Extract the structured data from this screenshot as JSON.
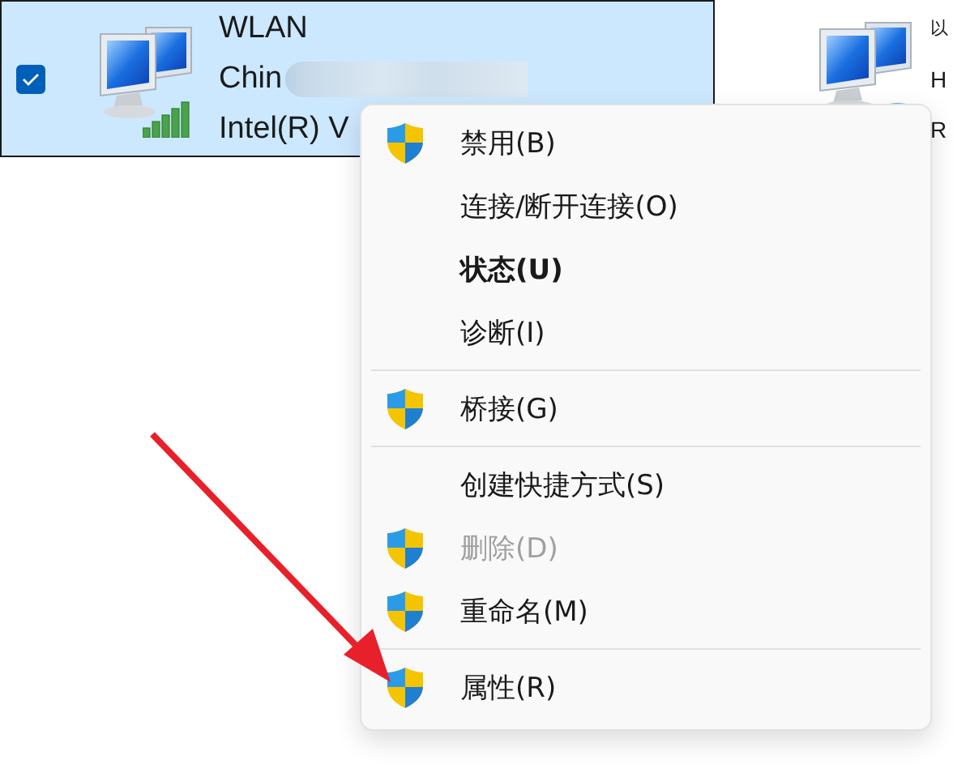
{
  "adapters": [
    {
      "name": "WLAN",
      "line_2": "Chin",
      "line_3": "Intel(R) V",
      "selected": true,
      "checked": true,
      "kind": "wireless",
      "blurred": true
    },
    {
      "name": "以",
      "line_2": "H",
      "line_3": "R",
      "selected": false,
      "kind": "wired"
    }
  ],
  "context_menu": {
    "items": [
      {
        "kind": "item",
        "label": "禁用(B)",
        "shield": true,
        "disabled": false,
        "default": false
      },
      {
        "kind": "item",
        "label": "连接/断开连接(O)",
        "shield": false,
        "disabled": false,
        "default": false
      },
      {
        "kind": "item",
        "label": "状态(U)",
        "shield": false,
        "disabled": false,
        "default": true
      },
      {
        "kind": "item",
        "label": "诊断(I)",
        "shield": false,
        "disabled": false,
        "default": false
      },
      {
        "kind": "separator"
      },
      {
        "kind": "item",
        "label": "桥接(G)",
        "shield": true,
        "disabled": false,
        "default": false
      },
      {
        "kind": "separator"
      },
      {
        "kind": "item",
        "label": "创建快捷方式(S)",
        "shield": false,
        "disabled": false,
        "default": false
      },
      {
        "kind": "item",
        "label": "删除(D)",
        "shield": true,
        "disabled": true,
        "default": false
      },
      {
        "kind": "item",
        "label": "重命名(M)",
        "shield": true,
        "disabled": false,
        "default": false
      },
      {
        "kind": "separator"
      },
      {
        "kind": "item",
        "label": "属性(R)",
        "shield": true,
        "disabled": false,
        "default": false
      }
    ]
  }
}
